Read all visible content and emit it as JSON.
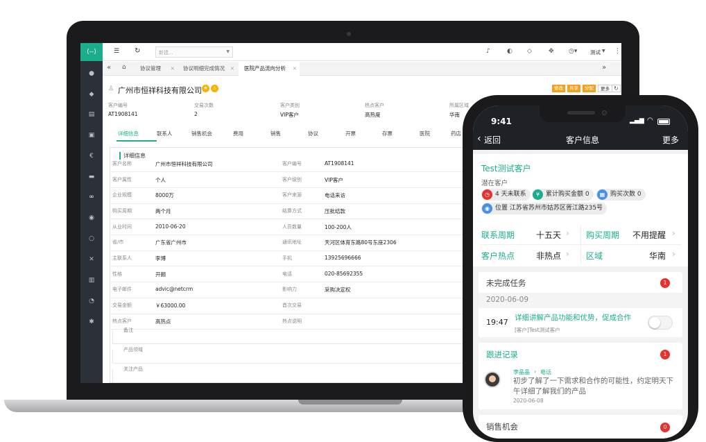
{
  "desktop": {
    "logo": "(--)",
    "new_placeholder": "新建...",
    "user_name": "测试",
    "tabs": [
      "协议管理",
      "协议明细完成情况",
      "医院产品流向分析"
    ],
    "company_name": "广州市恒祥科技有限公司",
    "action_buttons": [
      "修改",
      "共享",
      "分配",
      "更多"
    ],
    "summary": [
      {
        "label": "客户编号",
        "value": "AT1908141"
      },
      {
        "label": "交易次数",
        "value": "2"
      },
      {
        "label": "客户类别",
        "value": "VIP客户"
      },
      {
        "label": "热点客户",
        "value": "高热度"
      },
      {
        "label": "所属区域",
        "value": "华南"
      }
    ],
    "subtabs": [
      "详细信息",
      "联系人",
      "销售机会",
      "费用",
      "销售",
      "协议",
      "开票",
      "存票",
      "医院",
      "药店"
    ],
    "section_title": "详细信息",
    "left_fields": [
      {
        "label": "客户名称",
        "value": "广州市恒祥科技有限公司"
      },
      {
        "label": "客户属性",
        "value": "个人"
      },
      {
        "label": "企业规模",
        "value": "8000万"
      },
      {
        "label": "购买周期",
        "value": "两个月"
      },
      {
        "label": "从业时间",
        "value": "2010-06-20"
      },
      {
        "label": "省/市",
        "value": "广东省广州市"
      },
      {
        "label": "主联系人",
        "value": "李博"
      },
      {
        "label": "性格",
        "value": "开朗"
      },
      {
        "label": "电子邮件",
        "value": "advic@netcrm"
      },
      {
        "label": "交易金额",
        "value": "￥63000.00"
      },
      {
        "label": "热点客户",
        "value": "高热点"
      }
    ],
    "right_fields": [
      {
        "label": "客户编号",
        "value": "AT1908141"
      },
      {
        "label": "客户级别",
        "value": "VIP客户"
      },
      {
        "label": "客户来源",
        "value": "电话来访"
      },
      {
        "label": "结算方式",
        "value": "压批结款"
      },
      {
        "label": "人员数量",
        "value": "100-200人"
      },
      {
        "label": "通讯地址",
        "value": "天河区体育东路80号东座2306"
      },
      {
        "label": "手机",
        "value": "13925696666"
      },
      {
        "label": "电话",
        "value": "020-85692355"
      },
      {
        "label": "影响力",
        "value": "采购决定权"
      },
      {
        "label": "首次交易",
        "value": ""
      },
      {
        "label": "热点说明",
        "value": ""
      }
    ],
    "extra_labels": [
      "备注",
      "产品领域",
      "关注产品"
    ]
  },
  "phone": {
    "time": "9:41",
    "back_label": "返回",
    "title": "客户信息",
    "more_label": "更多",
    "customer_name": "Test测试客户",
    "customer_status": "潜在客户",
    "chips": [
      "4 天未联系",
      "累计购买金额 0",
      "购买次数 0"
    ],
    "location": "位置 江苏省苏州市姑苏区胥江路235号",
    "grid": [
      {
        "label": "联系周期",
        "value": "十五天"
      },
      {
        "label": "购买周期",
        "value": "不用提醒"
      },
      {
        "label": "客户热点",
        "value": "非热点"
      },
      {
        "label": "区域",
        "value": "华南"
      }
    ],
    "tasks": {
      "title": "未完成任务",
      "count": "1",
      "date": "2020-06-09",
      "time": "19:47",
      "text": "详细讲解产品功能和优势，促成合作",
      "sub": "[客户]Test测试客户"
    },
    "followup": {
      "title": "跟进记录",
      "count": "1",
      "person": "李晶晶",
      "type": "电话",
      "text": "初步了解了一下需求和合作的可能性，约定明天下午详细了解我们的产品",
      "date": "2020-06-08"
    },
    "opportunity": {
      "title": "销售机会",
      "count": "0"
    },
    "colors": {
      "accent": "#1cae8c",
      "alert": "#e8302c",
      "header": "#1e2226"
    }
  }
}
